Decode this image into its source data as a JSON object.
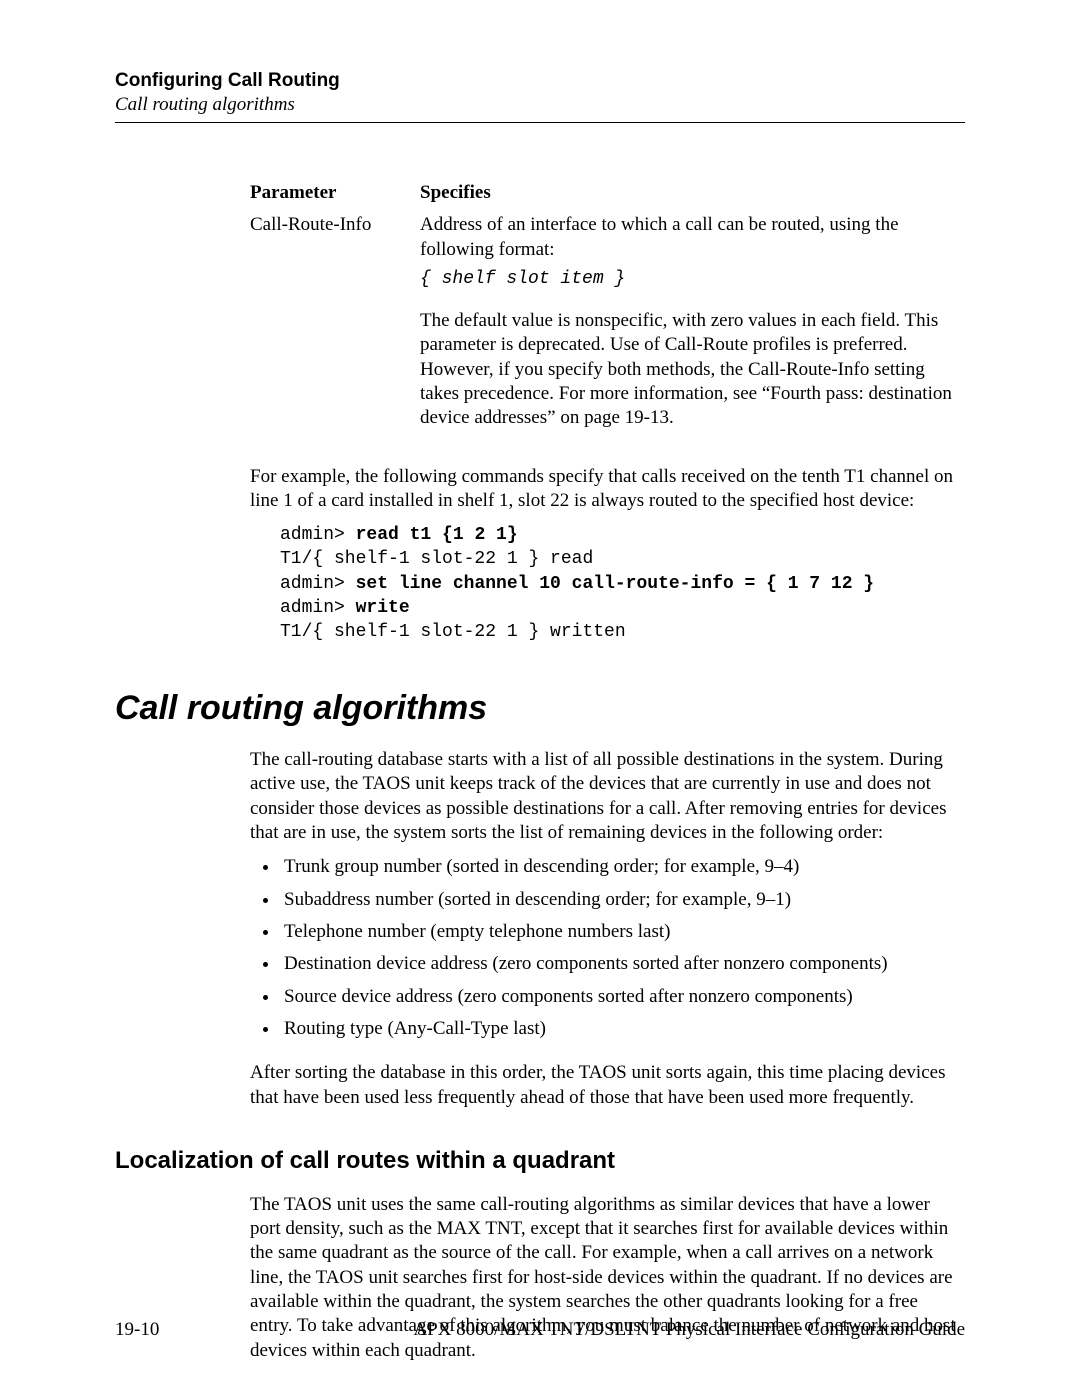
{
  "header": {
    "title": "Configuring Call Routing",
    "subtitle": "Call routing algorithms"
  },
  "paramTable": {
    "head": {
      "c1": "Parameter",
      "c2": "Specifies"
    },
    "row": {
      "name": "Call-Route-Info",
      "desc1": "Address of an interface to which a call can be routed, using the following format:",
      "code": "{ shelf slot item }",
      "desc2": "The default value is nonspecific, with zero values in each field. This parameter is deprecated. Use of Call-Route profiles is preferred. However, if you specify both methods, the Call-Route-Info setting takes precedence. For more information, see “Fourth pass: destination device addresses” on page 19-13."
    }
  },
  "examplePara": "For example, the following commands specify that calls received on the tenth T1 channel on line 1 of a card installed in shelf 1, slot 22 is always routed to the specified host device:",
  "terminal": {
    "l1p": "admin> ",
    "l1b": "read t1 {1 2 1}",
    "l2": "T1/{ shelf-1 slot-22 1 } read",
    "l3p": "admin> ",
    "l3b": "set line channel 10 call-route-info = { 1 7 12 }",
    "l4p": "admin> ",
    "l4b": "write",
    "l5": "T1/{ shelf-1 slot-22 1 } written"
  },
  "section": {
    "h1": "Call routing algorithms",
    "intro": "The call-routing database starts with a list of all possible destinations in the system. During active use, the TAOS unit keeps track of the devices that are currently in use and does not consider those devices as possible destinations for a call. After removing entries for devices that are in use, the system sorts the list of remaining devices in the following order:",
    "items": [
      "Trunk group number (sorted in descending order; for example, 9–4)",
      "Subaddress number (sorted in descending order; for example, 9–1)",
      "Telephone number (empty telephone numbers last)",
      "Destination device address (zero components sorted after nonzero components)",
      "Source device address (zero components sorted after nonzero components)",
      "Routing type (Any-Call-Type last)"
    ],
    "outro": "After sorting the database in this order, the TAOS unit sorts again, this time placing devices that have been used less frequently ahead of those that have been used more frequently."
  },
  "subsection": {
    "h2": "Localization of call routes within a quadrant",
    "body": "The TAOS unit uses the same call-routing algorithms as similar devices that have a lower port density, such as the MAX TNT, except that it searches first for available devices within the same quadrant as the source of the call. For example, when a call arrives on a network line, the TAOS unit searches first for host-side devices within the quadrant. If no devices are available within the quadrant, the system searches the other quadrants looking for a free entry. To take advantage of this algorithm, you must balance the number of network and host devices within each quadrant."
  },
  "footer": {
    "page": "19-10",
    "book": "APX 8000/MAX TNT/DSLTNT Physical Interface Configuration Guide"
  }
}
